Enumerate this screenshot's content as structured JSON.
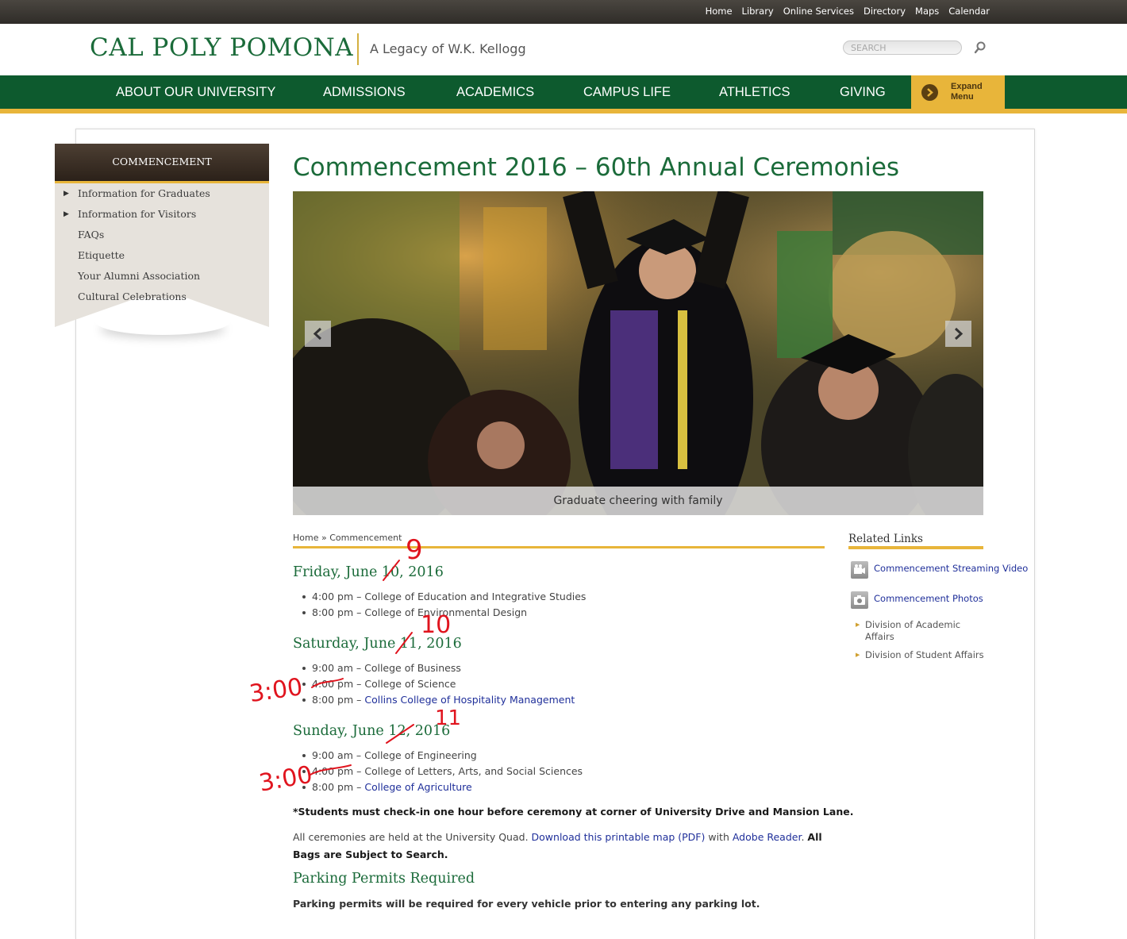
{
  "utility_nav": [
    "Home",
    "Library",
    "Online Services",
    "Directory",
    "Maps",
    "Calendar"
  ],
  "header": {
    "logo": "CAL POLY POMONA",
    "tagline": "A Legacy of W.K. Kellogg",
    "search_placeholder": "SEARCH"
  },
  "main_nav": [
    "ABOUT OUR UNIVERSITY",
    "ADMISSIONS",
    "ACADEMICS",
    "CAMPUS LIFE",
    "ATHLETICS",
    "GIVING"
  ],
  "expand_menu": {
    "line1": "Expand",
    "line2": "Menu"
  },
  "sidebar": {
    "title": "COMMENCEMENT",
    "items": [
      "Information for Graduates",
      "Information for Visitors",
      "FAQs",
      "Etiquette",
      "Your Alumni Association",
      "Cultural Celebrations"
    ]
  },
  "page_title": "Commencement 2016 – 60th Annual Ceremonies",
  "slideshow": {
    "caption": "Graduate cheering with family"
  },
  "breadcrumb": {
    "home": "Home",
    "separator": "»",
    "current": "Commencement"
  },
  "schedule": [
    {
      "day": "Friday, June 10, 2016",
      "events": [
        {
          "time": "4:00 pm",
          "sep": " – ",
          "name": "College of Education and Integrative Studies",
          "link": false
        },
        {
          "time": "8:00 pm",
          "sep": " – ",
          "name": "College of Environmental Design",
          "link": false
        }
      ]
    },
    {
      "day": "Saturday, June 11, 2016",
      "events": [
        {
          "time": "9:00 am",
          "sep": " – ",
          "name": "College of Business",
          "link": false
        },
        {
          "time": "4:00 pm",
          "sep": " – ",
          "name": "College of Science",
          "link": false
        },
        {
          "time": "8:00 pm",
          "sep": " – ",
          "name": "Collins College of Hospitality Management",
          "link": true
        }
      ]
    },
    {
      "day": "Sunday, June 12, 2016",
      "events": [
        {
          "time": "9:00 am",
          "sep": " – ",
          "name": "College of Engineering",
          "link": false
        },
        {
          "time": "4:00 pm",
          "sep": " – ",
          "name": "College of Letters, Arts, and Social Sciences",
          "link": false
        },
        {
          "time": "8:00 pm",
          "sep": " – ",
          "name": "College of Agriculture",
          "link": true
        }
      ]
    }
  ],
  "checkin_note": "*Students must check-in one hour before ceremony at corner of University Drive and Mansion Lane.",
  "ceremony_info": {
    "text1": "All ceremonies are held at the University Quad. ",
    "map_link": "Download this printable map (PDF)",
    "text2": " with ",
    "reader_link": "Adobe Reader",
    "text3": ". ",
    "bold": "All Bags are Subject to Search."
  },
  "parking": {
    "title": "Parking Permits Required",
    "text": "Parking permits will be required for every vehicle prior to entering any parking lot."
  },
  "related_links": {
    "title": "Related Links",
    "icon_links": [
      "Commencement Streaming Video",
      "Commencement Photos"
    ],
    "text_links": [
      "Division of Academic Affairs",
      "Division of Student Affairs"
    ]
  },
  "handwritten_annotations": [
    "9",
    "10",
    "11",
    "3:00",
    "3:00"
  ],
  "colors": {
    "brand_green": "#1b6b3a",
    "nav_green": "#0d5a2e",
    "gold": "#e8b53a",
    "annotation_red": "#e0141e"
  }
}
